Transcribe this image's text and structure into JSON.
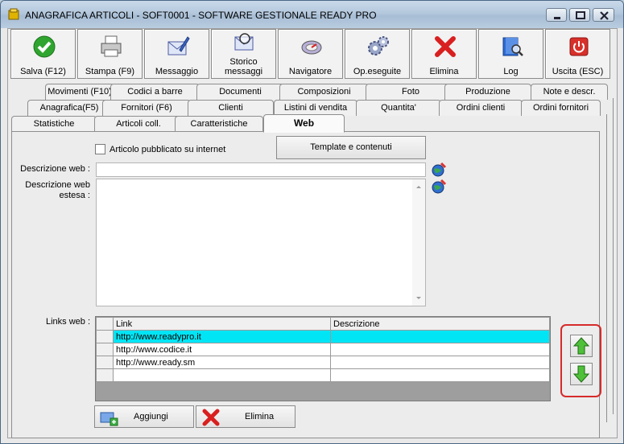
{
  "window": {
    "title": "ANAGRAFICA ARTICOLI - SOFT0001 - SOFTWARE GESTIONALE READY PRO"
  },
  "toolbar": {
    "buttons": [
      {
        "label": "Salva (F12)",
        "icon": "check-icon"
      },
      {
        "label": "Stampa (F9)",
        "icon": "printer-icon"
      },
      {
        "label": "Messaggio",
        "icon": "message-pen-icon"
      },
      {
        "label": "Storico messaggi",
        "line1": "Storico",
        "line2": "messaggi",
        "icon": "message-search-icon"
      },
      {
        "label": "Navigatore",
        "icon": "compass-icon"
      },
      {
        "label": "Op.eseguite",
        "icon": "gears-icon"
      },
      {
        "label": "Elimina",
        "icon": "red-x-icon"
      },
      {
        "label": "Log",
        "icon": "book-search-icon"
      },
      {
        "label": "Uscita (ESC)",
        "icon": "power-icon"
      }
    ]
  },
  "tabs": {
    "row1": [
      "Movimenti (F10)",
      "Codici a barre",
      "Documenti",
      "Composizioni",
      "Foto",
      "Produzione",
      "Note e descr."
    ],
    "row2": [
      "Anagrafica(F5)",
      "Fornitori (F6)",
      "Clienti",
      "Listini di vendita",
      "Quantita'",
      "Ordini clienti",
      "Ordini fornitori"
    ],
    "row3": [
      "Statistiche",
      "Articoli coll.",
      "Caratteristiche",
      "Web"
    ],
    "active": "Web"
  },
  "web": {
    "published_label": "Articolo pubblicato su internet",
    "published_checked": false,
    "template_button": "Template e contenuti",
    "descrizione_label": "Descrizione web :",
    "descrizione_value": "",
    "estesa_label_line1": "Descrizione web",
    "estesa_label_line2": "estesa :",
    "estesa_value": "",
    "links_label": "Links web :",
    "links_columns": [
      "Link",
      "Descrizione"
    ],
    "links_rows": [
      {
        "link": "http://www.readypro.it",
        "descrizione": "",
        "selected": true
      },
      {
        "link": "http://www.codice.it",
        "descrizione": "",
        "selected": false
      },
      {
        "link": "http://www.ready.sm",
        "descrizione": "",
        "selected": false
      },
      {
        "link": "",
        "descrizione": "",
        "selected": false
      }
    ],
    "add_button": "Aggiungi",
    "delete_button": "Elimina"
  }
}
